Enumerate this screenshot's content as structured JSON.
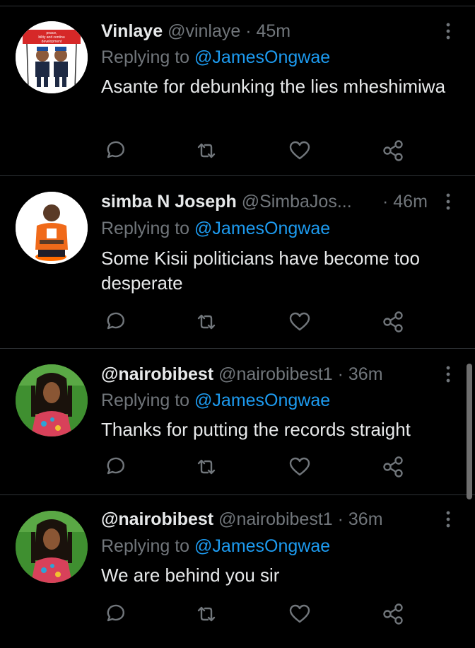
{
  "tweets": [
    {
      "name": "Vinlaye",
      "handle": "@vinlaye",
      "dot": "·",
      "time": "45m",
      "replying_prefix": "Replying to ",
      "replying_to": "@JamesOngwae",
      "text": "Asante for debunking the lies mheshimiwa",
      "avatar": "avatar-cartoon-poster"
    },
    {
      "name": "simba  N Joseph",
      "handle": "@SimbaJos...",
      "dot": "·",
      "time": "46m",
      "replying_prefix": "Replying to ",
      "replying_to": "@JamesOngwae",
      "text": "Some Kisii politicians have become too desperate",
      "avatar": "avatar-man-orange-shirt"
    },
    {
      "name": "@nairobibest",
      "handle": "@nairobibest1",
      "dot": "·",
      "time": "36m",
      "replying_prefix": "Replying to ",
      "replying_to": "@JamesOngwae",
      "text": "Thanks for putting the records straight",
      "avatar": "avatar-woman-braids"
    },
    {
      "name": "@nairobibest",
      "handle": "@nairobibest1",
      "dot": "·",
      "time": "36m",
      "replying_prefix": "Replying to ",
      "replying_to": "@JamesOngwae",
      "text": "We are behind you sir",
      "avatar": "avatar-woman-braids"
    }
  ],
  "avatar_poster_text": [
    "peace,",
    "bility and continu",
    "development"
  ],
  "icons": {
    "more": "more-vertical-icon",
    "reply": "reply-bubble-icon",
    "retweet": "retweet-icon",
    "like": "heart-icon",
    "share": "share-icon"
  },
  "colors": {
    "background": "#000000",
    "text_primary": "#e7e9ea",
    "text_secondary": "#71767b",
    "mention": "#1d9bf0",
    "divider": "#2f3336"
  }
}
